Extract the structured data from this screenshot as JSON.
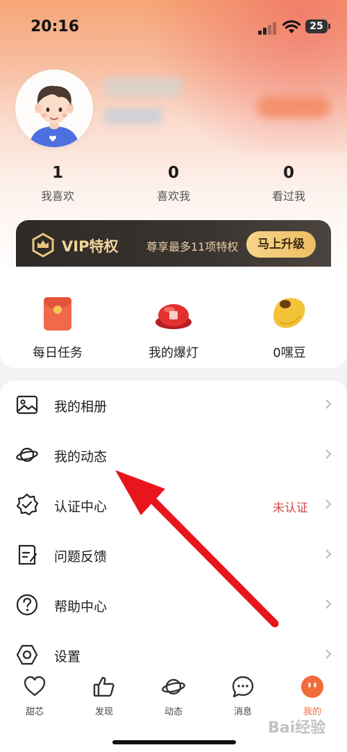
{
  "status_bar": {
    "time": "20:16",
    "battery": "25"
  },
  "profile": {
    "stats": [
      {
        "value": "1",
        "label": "我喜欢"
      },
      {
        "value": "0",
        "label": "喜欢我"
      },
      {
        "value": "0",
        "label": "看过我"
      }
    ]
  },
  "vip": {
    "title": "VIP特权",
    "description": "尊享最多11项特权",
    "button": "马上升级"
  },
  "quick_actions": [
    {
      "label": "每日任务",
      "icon": "red-envelope-icon"
    },
    {
      "label": "我的爆灯",
      "icon": "red-bomb-light-icon"
    },
    {
      "label": "0嘿豆",
      "icon": "bean-icon"
    }
  ],
  "menu": [
    {
      "label": "我的相册",
      "icon": "photo-album-icon",
      "status": ""
    },
    {
      "label": "我的动态",
      "icon": "planet-icon",
      "status": ""
    },
    {
      "label": "认证中心",
      "icon": "badge-check-icon",
      "status": "未认证"
    },
    {
      "label": "问题反馈",
      "icon": "feedback-note-icon",
      "status": ""
    },
    {
      "label": "帮助中心",
      "icon": "question-circle-icon",
      "status": ""
    },
    {
      "label": "设置",
      "icon": "settings-hexagon-icon",
      "status": ""
    }
  ],
  "tabs": [
    {
      "label": "甜芯",
      "icon": "heart-icon"
    },
    {
      "label": "发现",
      "icon": "thumbs-up-icon"
    },
    {
      "label": "动态",
      "icon": "planet-icon"
    },
    {
      "label": "消息",
      "icon": "chat-bubble-icon"
    },
    {
      "label": "我的",
      "icon": "face-icon",
      "active": true
    }
  ],
  "watermark": "Bai经验",
  "colors": {
    "accent": "#f26b3a",
    "status_red": "#d6484a",
    "vip_gold": "#f0d49c"
  }
}
